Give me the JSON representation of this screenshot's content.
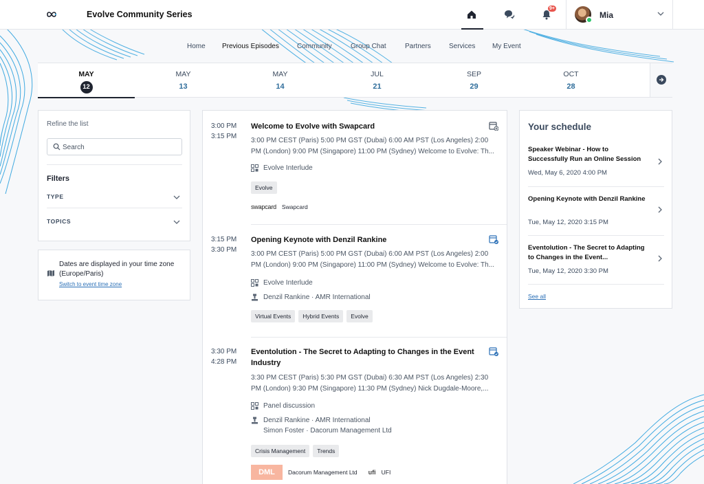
{
  "app": {
    "title": "Evolve Community Series",
    "logo_icon": "infinity-logo-icon",
    "notification_badge": "9+",
    "user_name": "Mia",
    "colors": {
      "accent": "#2a6fb6",
      "dark": "#1f2430",
      "online": "#2bc46a",
      "badge": "#e8554d",
      "wave": "#3fa9e0"
    }
  },
  "nav": {
    "items": [
      "Home",
      "Previous Episodes",
      "Community",
      "Group Chat",
      "Partners",
      "Services",
      "My Event"
    ],
    "active": "Previous Episodes"
  },
  "dates": [
    {
      "month": "MAY",
      "day": "12",
      "selected": true
    },
    {
      "month": "MAY",
      "day": "13"
    },
    {
      "month": "MAY",
      "day": "14"
    },
    {
      "month": "JUL",
      "day": "21"
    },
    {
      "month": "SEP",
      "day": "29"
    },
    {
      "month": "OCT",
      "day": "28"
    }
  ],
  "filters": {
    "refine_label": "Refine the list",
    "search_placeholder": "Search",
    "title": "Filters",
    "items": [
      "TYPE",
      "TOPICS"
    ]
  },
  "timezone": {
    "text": "Dates are displayed in your time zone (Europe/Paris)",
    "link": "Switch to event time zone"
  },
  "sessions": [
    {
      "start": "3:00 PM",
      "end": "3:15 PM",
      "title": "Welcome to Evolve with Swapcard",
      "description": "3:00 PM CEST (Paris) 5:00 PM GST (Dubai) 6:00 AM PST (Los Angeles) 2:00 PM (London) 9:00 PM (Singapore) 11:00 PM (Sydney) Welcome to Evolve: Th...",
      "format": "Evolve Interlude",
      "tags": [
        "Evolve"
      ],
      "sponsor_logo": "swapcard",
      "sponsor": "Swapcard",
      "in_schedule": false
    },
    {
      "start": "3:15 PM",
      "end": "3:30 PM",
      "title": "Opening Keynote with Denzil Rankine",
      "description": "3:00 PM CEST (Paris) 5:00 PM GST (Dubai) 6:00 AM PST (Los Angeles) 2:00 PM (London) 9:00 PM (Singapore) 11:00 PM (Sydney) Welcome to Evolve: Th...",
      "format": "Evolve Interlude",
      "speaker": "Denzil Rankine · AMR International",
      "tags": [
        "Virtual Events",
        "Hybrid Events",
        "Evolve"
      ],
      "in_schedule": true
    },
    {
      "start": "3:30 PM",
      "end": "4:28 PM",
      "title": "Eventolution - The Secret to Adapting to Changes in the Event Industry",
      "description": "3:30 PM CEST (Paris) 5:30 PM GST (Dubai) 6:30 AM PST (Los Angeles) 2:30 PM (London) 9:30 PM (Singapore) 11:30 PM (Sydney) Nick Dugdale-Moore,...",
      "format": "Panel discussion",
      "speaker": "Denzil Rankine · AMR International",
      "speaker2": "Simon Foster · Dacorum Management Ltd",
      "tags": [
        "Crisis Management",
        "Trends"
      ],
      "sponsor1_logo": "DML",
      "sponsor1": "Dacorum Management Ltd",
      "sponsor2_logo": "ufi",
      "sponsor2": "UFI",
      "in_schedule": true
    }
  ],
  "schedule": {
    "title": "Your schedule",
    "items": [
      {
        "title": "Speaker Webinar - How to Successfully Run an Online Session",
        "date": "Wed, May 6, 2020 4:00 PM"
      },
      {
        "title": "Opening Keynote with Denzil Rankine",
        "date": "Tue, May 12, 2020 3:15 PM"
      },
      {
        "title": "Eventolution - The Secret to Adapting to Changes in the Event...",
        "date": "Tue, May 12, 2020 3:30 PM"
      }
    ],
    "see_all": "See all"
  }
}
